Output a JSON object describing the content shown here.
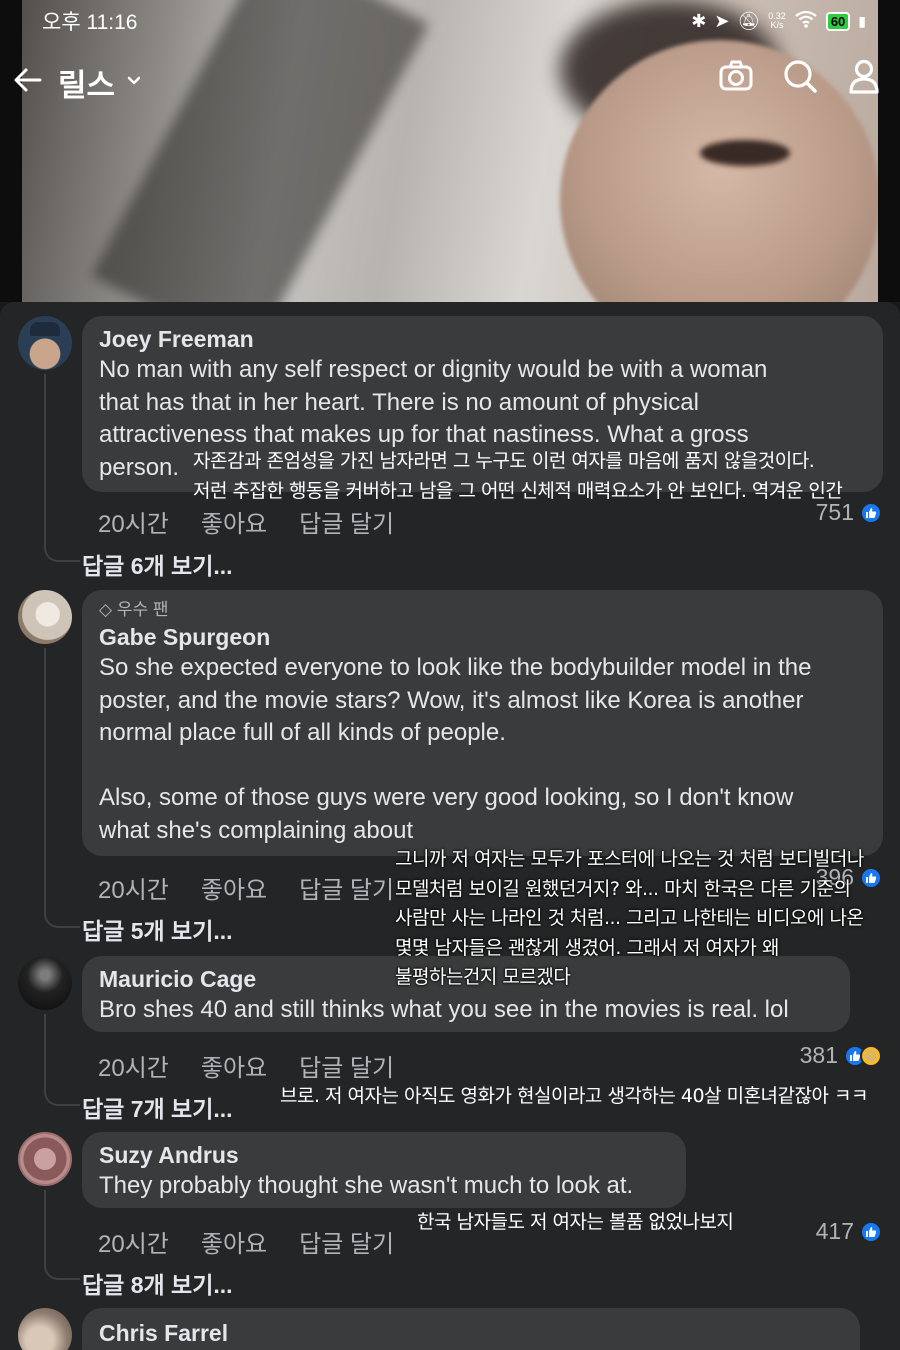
{
  "status_bar": {
    "time": "오후 11:16",
    "net_speed": "0.32\nK/s",
    "battery": "60"
  },
  "nav": {
    "title": "릴스"
  },
  "comments": [
    {
      "author": "Joey Freeman",
      "text": "No man with any self respect or dignity would be with a woman\nthat has that in her heart. There is no amount of physical\nattractiveness that makes up for that nastiness. What a gross\nperson.",
      "time": "20시간",
      "like": "좋아요",
      "reply": "답글 달기",
      "reaction_count": "751",
      "view_replies": "답글 6개 보기...",
      "translation": "자존감과 존엄성을 가진 남자라면 그 누구도 이런 여자를 마음에 품지 않을것이다.\n저런 추잡한 행동을 커버하고 남을 그 어떤 신체적 매력요소가 안 보인다. 역겨운 인간"
    },
    {
      "badge": "우수 팬",
      "author": "Gabe Spurgeon",
      "text": "So she expected everyone to look like the bodybuilder model in the\nposter, and the movie stars? Wow, it's almost like Korea is another\nnormal place full of all kinds of people.\n\nAlso, some of those guys were very good looking, so I don't know\nwhat she's complaining about",
      "time": "20시간",
      "like": "좋아요",
      "reply": "답글 달기",
      "reaction_count": "396",
      "view_replies": "답글 5개 보기...",
      "translation": "그니까 저 여자는 모두가 포스터에 나오는 것 처럼 보디빌더나\n모델처럼 보이길 원했던거지? 와... 마치 한국은 다른 기준의\n사람만 사는 나라인 것 처럼... 그리고 나한테는 비디오에 나온\n몇몇 남자들은 괜찮게 생겼어. 그래서 저 여자가 왜\n불평하는건지 모르겠다"
    },
    {
      "author": "Mauricio Cage",
      "text": "Bro shes 40 and still thinks what you see in the movies is real. lol",
      "time": "20시간",
      "like": "좋아요",
      "reply": "답글 달기",
      "reaction_count": "381",
      "view_replies": "답글 7개 보기...",
      "translation": "브로. 저 여자는 아직도 영화가 현실이라고 생각하는 40살 미혼녀같잖아 ㅋㅋ"
    },
    {
      "author": "Suzy Andrus",
      "text": "They probably thought she wasn't much to look at.",
      "time": "20시간",
      "like": "좋아요",
      "reply": "답글 달기",
      "reaction_count": "417",
      "view_replies": "답글 8개 보기...",
      "translation": "한국 남자들도 저 여자는 볼품 없었나보지"
    },
    {
      "author": "Chris Farrel"
    }
  ],
  "icons": [
    "back-arrow-icon",
    "chevron-down-icon",
    "camera-icon",
    "search-icon",
    "profile-icon",
    "like-icon",
    "haha-icon",
    "diamond-icon"
  ],
  "colors": {
    "panel_bg": "#242526",
    "bubble_bg": "#3a3b3c",
    "text_primary": "#e4e6eb",
    "text_secondary": "#b0b3b8",
    "like_blue": "#1877f2"
  }
}
